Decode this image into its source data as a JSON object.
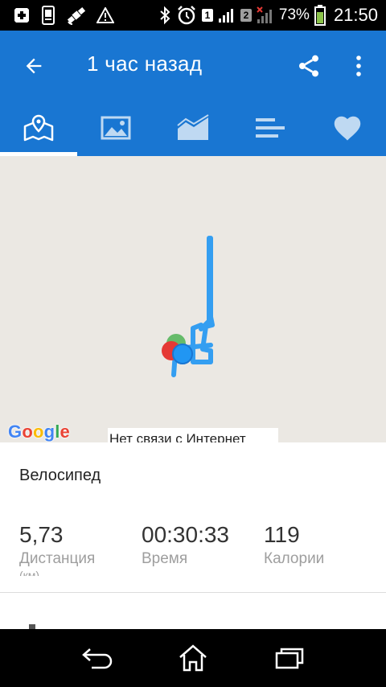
{
  "status_bar": {
    "battery_percent": "73%",
    "time": "21:50",
    "sim1": "1",
    "sim2": "2",
    "icons": [
      "plus-square-icon",
      "phone-screen-icon",
      "satellite-icon",
      "warning-icon",
      "bluetooth-icon",
      "alarm-clock-icon",
      "signal-icon",
      "no-signal-icon",
      "battery-charging-icon"
    ]
  },
  "app_bar": {
    "title": "1 час назад",
    "back_icon": "arrow-back-icon",
    "share_icon": "share-icon",
    "more_icon": "more-vert-icon",
    "color": "#1976d2"
  },
  "tabs": [
    {
      "name": "map",
      "icon": "map-icon",
      "active": true
    },
    {
      "name": "photos",
      "icon": "image-icon",
      "active": false
    },
    {
      "name": "charts",
      "icon": "area-chart-icon",
      "active": false
    },
    {
      "name": "splits",
      "icon": "list-bars-icon",
      "active": false
    },
    {
      "name": "likes",
      "icon": "heart-icon",
      "active": false
    }
  ],
  "map": {
    "logo": "Google",
    "notice": "Нет связи с Интернет",
    "route_color": "#2196f3",
    "start_marker_color": "#4caf50",
    "end_marker_color": "#e53935"
  },
  "details": {
    "activity_type": "Велосипед",
    "stats": [
      {
        "value": "5,73",
        "label": "Дистанция",
        "sub": "(км)"
      },
      {
        "value": "00:30:33",
        "label": "Время",
        "sub": ""
      },
      {
        "value": "119",
        "label": "Калории",
        "sub": ""
      }
    ]
  },
  "nav_bar": {
    "back_icon": "nav-back-icon",
    "home_icon": "nav-home-icon",
    "recents_icon": "nav-recents-icon"
  }
}
